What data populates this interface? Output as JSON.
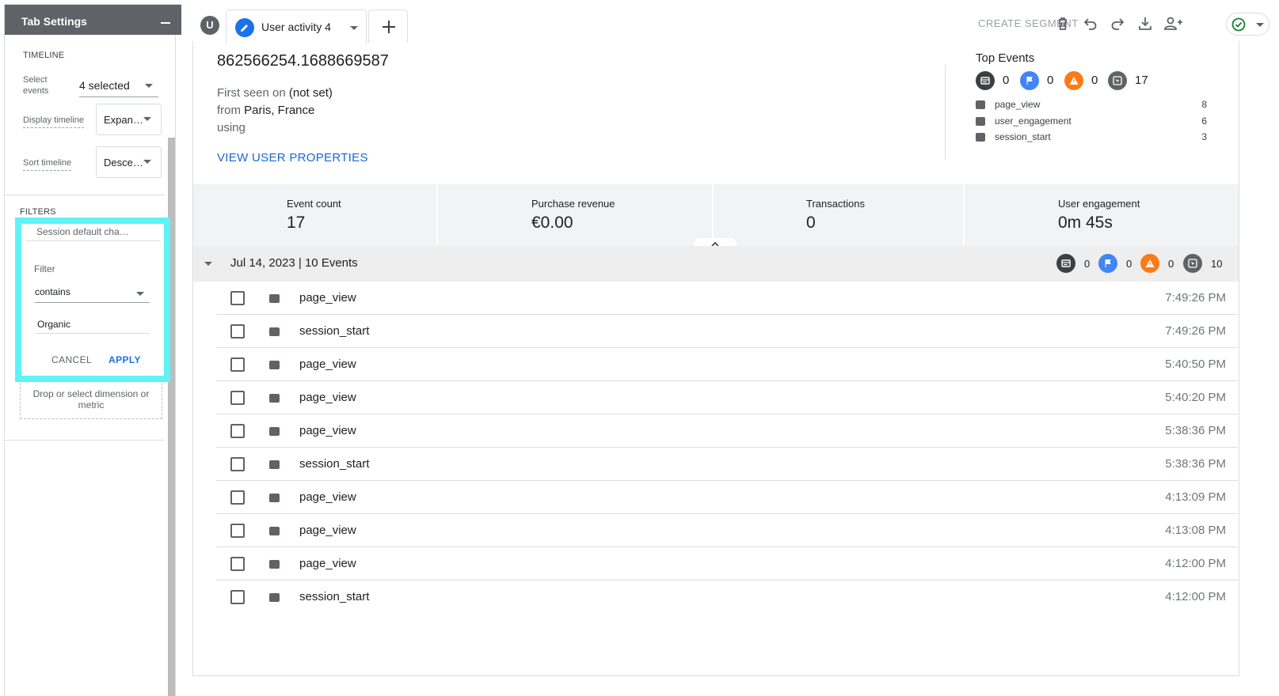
{
  "panel": {
    "title": "Tab Settings",
    "timeline_section": "TIMELINE",
    "select_events_label": "Select events",
    "select_events_value": "4 selected",
    "display_timeline_label": "Display timeline",
    "display_timeline_value": "Expan…",
    "sort_timeline_label": "Sort timeline",
    "sort_timeline_value": "Desce…",
    "filters_section": "FILTERS",
    "filter_popup": {
      "dimension": "Session default cha…",
      "filter_label": "Filter",
      "match_type": "contains",
      "value": "Organic",
      "cancel_label": "CANCEL",
      "apply_label": "APPLY"
    },
    "drop_zone": "Drop or select dimension or metric"
  },
  "top_bar": {
    "avatar_letter": "U",
    "tab_label": "User activity 4",
    "create_segment": "CREATE SEGMENT"
  },
  "user": {
    "id": "862566254.1688669587",
    "first_seen_prefix": "First seen on ",
    "first_seen_value": "(not set)",
    "from_prefix": "from ",
    "from_value": "Paris, France",
    "using": "using",
    "view_properties": "VIEW USER PROPERTIES"
  },
  "top_events": {
    "title": "Top Events",
    "badges": [
      {
        "icon": "web-icon",
        "count": "0",
        "color": "#3c4043"
      },
      {
        "icon": "flag-icon",
        "count": "0",
        "color": "#4285f4"
      },
      {
        "icon": "warning-icon",
        "count": "0",
        "color": "#fa7b17"
      },
      {
        "icon": "cursor-icon",
        "count": "17",
        "color": "#5f6368"
      }
    ],
    "items": [
      {
        "name": "page_view",
        "count": "8"
      },
      {
        "name": "user_engagement",
        "count": "6"
      },
      {
        "name": "session_start",
        "count": "3"
      }
    ]
  },
  "metrics": [
    {
      "label": "Event count",
      "value": "17"
    },
    {
      "label": "Purchase revenue",
      "value": "€0.00"
    },
    {
      "label": "Transactions",
      "value": "0"
    },
    {
      "label": "User engagement",
      "value": "0m 45s"
    }
  ],
  "day": {
    "title": "Jul 14, 2023 | 10 Events",
    "badge_counts": [
      "0",
      "0",
      "0",
      "10"
    ]
  },
  "events": [
    {
      "name": "page_view",
      "time": "7:49:26 PM"
    },
    {
      "name": "session_start",
      "time": "7:49:26 PM"
    },
    {
      "name": "page_view",
      "time": "5:40:50 PM"
    },
    {
      "name": "page_view",
      "time": "5:40:20 PM"
    },
    {
      "name": "page_view",
      "time": "5:38:36 PM"
    },
    {
      "name": "session_start",
      "time": "5:38:36 PM"
    },
    {
      "name": "page_view",
      "time": "4:13:09 PM"
    },
    {
      "name": "page_view",
      "time": "4:13:08 PM"
    },
    {
      "name": "page_view",
      "time": "4:12:00 PM"
    },
    {
      "name": "session_start",
      "time": "4:12:00 PM"
    }
  ]
}
